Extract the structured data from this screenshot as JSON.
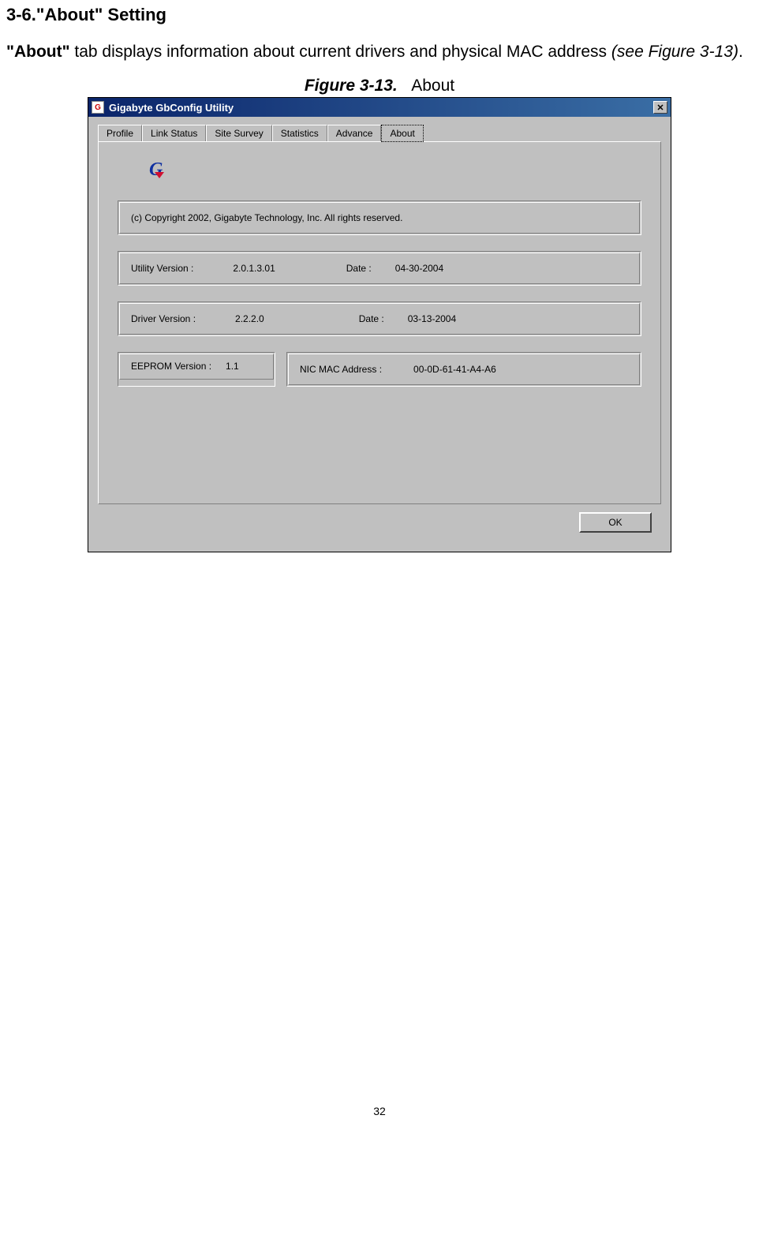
{
  "heading": "3-6.\"About\" Setting",
  "intro": {
    "bold": "\"About\"",
    "text": " tab displays information about current drivers and physical MAC address ",
    "italic": "(see Figure 3-13)",
    "end": "."
  },
  "figure": {
    "label": "Figure 3-13.",
    "caption": "About"
  },
  "dialog": {
    "title": "Gigabyte GbConfig Utility",
    "icon_text": "G",
    "close_glyph": "✕",
    "tabs": [
      "Profile",
      "Link Status",
      "Site Survey",
      "Statistics",
      "Advance",
      "About"
    ],
    "active_tab_index": 5,
    "copyright": "(c) Copyright 2002, Gigabyte Technology, Inc.  All rights reserved.",
    "utility": {
      "label": "Utility Version :",
      "value": "2.0.1.3.01",
      "date_label": "Date :",
      "date": "04-30-2004"
    },
    "driver": {
      "label": "Driver Version :",
      "value": "2.2.2.0",
      "date_label": "Date :",
      "date": "03-13-2004"
    },
    "eeprom": {
      "label": "EEPROM Version :",
      "value": "1.1"
    },
    "mac": {
      "label": "NIC MAC Address :",
      "value": "00-0D-61-41-A4-A6"
    },
    "ok_label": "OK"
  },
  "page_number": "32"
}
